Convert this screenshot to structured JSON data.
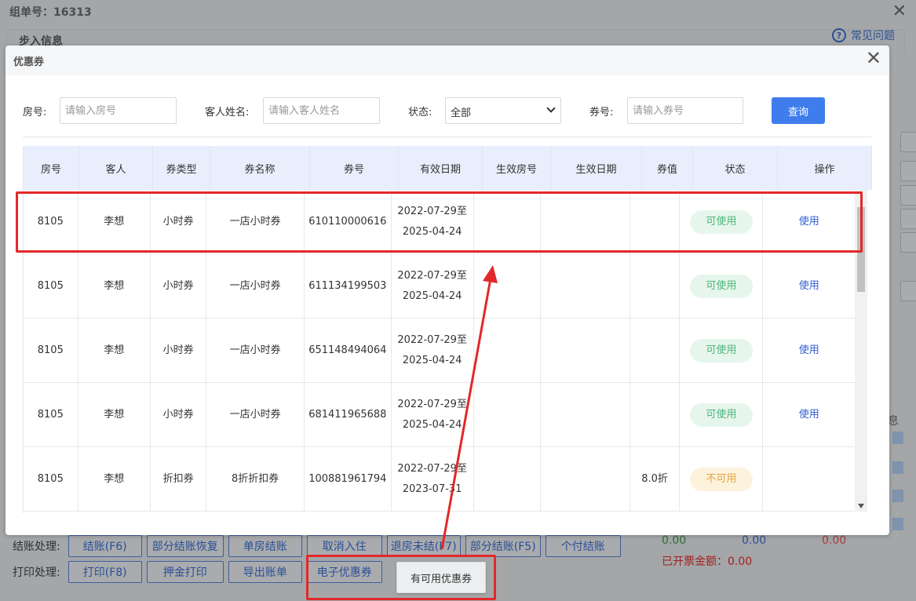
{
  "background": {
    "title": "组单号：16313",
    "section_label": "步入信息",
    "faq": "常见问题",
    "checkout_label": "结账处理:",
    "checkout_buttons": [
      "结账(F6)",
      "部分结账恢复",
      "单房结账",
      "取消入住",
      "退房未结(F7)",
      "部分结账(F5)",
      "个付结账"
    ],
    "print_label": "打印处理:",
    "print_buttons": [
      "打印(F8)",
      "押金打印",
      "导出账单",
      "电子优惠券"
    ],
    "amounts": [
      "0.00",
      "0.00",
      "0.00"
    ],
    "invoiced_amount": "已开票金额：0.00",
    "cut_text": "息"
  },
  "dialog": {
    "title": "优惠券",
    "filters": {
      "room_label": "房号:",
      "room_placeholder": "请输入房号",
      "guest_label": "客人姓名:",
      "guest_placeholder": "请输入客人姓名",
      "status_label": "状态:",
      "status_value": "全部",
      "coupon_label": "券号:",
      "coupon_placeholder": "请输入券号",
      "query_button": "查询"
    },
    "columns": [
      "房号",
      "客人",
      "券类型",
      "券名称",
      "券号",
      "有效日期",
      "生效房号",
      "生效日期",
      "券值",
      "状态",
      "操作"
    ],
    "rows": [
      {
        "room": "8105",
        "guest": "李想",
        "type": "小时券",
        "name": "一店小时券",
        "code": "610110000616",
        "valid_from": "2022-07-29至",
        "valid_to": "2025-04-24",
        "eff_room": "",
        "eff_date": "",
        "value": "",
        "status": "可使用",
        "action": "使用"
      },
      {
        "room": "8105",
        "guest": "李想",
        "type": "小时券",
        "name": "一店小时券",
        "code": "611134199503",
        "valid_from": "2022-07-29至",
        "valid_to": "2025-04-24",
        "eff_room": "",
        "eff_date": "",
        "value": "",
        "status": "可使用",
        "action": "使用"
      },
      {
        "room": "8105",
        "guest": "李想",
        "type": "小时券",
        "name": "一店小时券",
        "code": "651148494064",
        "valid_from": "2022-07-29至",
        "valid_to": "2025-04-24",
        "eff_room": "",
        "eff_date": "",
        "value": "",
        "status": "可使用",
        "action": "使用"
      },
      {
        "room": "8105",
        "guest": "李想",
        "type": "小时券",
        "name": "一店小时券",
        "code": "681411965688",
        "valid_from": "2022-07-29至",
        "valid_to": "2025-04-24",
        "eff_room": "",
        "eff_date": "",
        "value": "",
        "status": "可使用",
        "action": "使用"
      },
      {
        "room": "8105",
        "guest": "李想",
        "type": "折扣券",
        "name": "8折折扣券",
        "code": "100881961794",
        "valid_from": "2022-07-29至",
        "valid_to": "2023-07-31",
        "eff_room": "",
        "eff_date": "",
        "value": "8.0折",
        "status": "不可用",
        "action": ""
      }
    ]
  },
  "tooltip": "有可用优惠券",
  "colors": {
    "accent": "#3f7ded",
    "annotation": "#e2282a",
    "status_ok": "#4cb57a",
    "status_no": "#e2a53b"
  }
}
